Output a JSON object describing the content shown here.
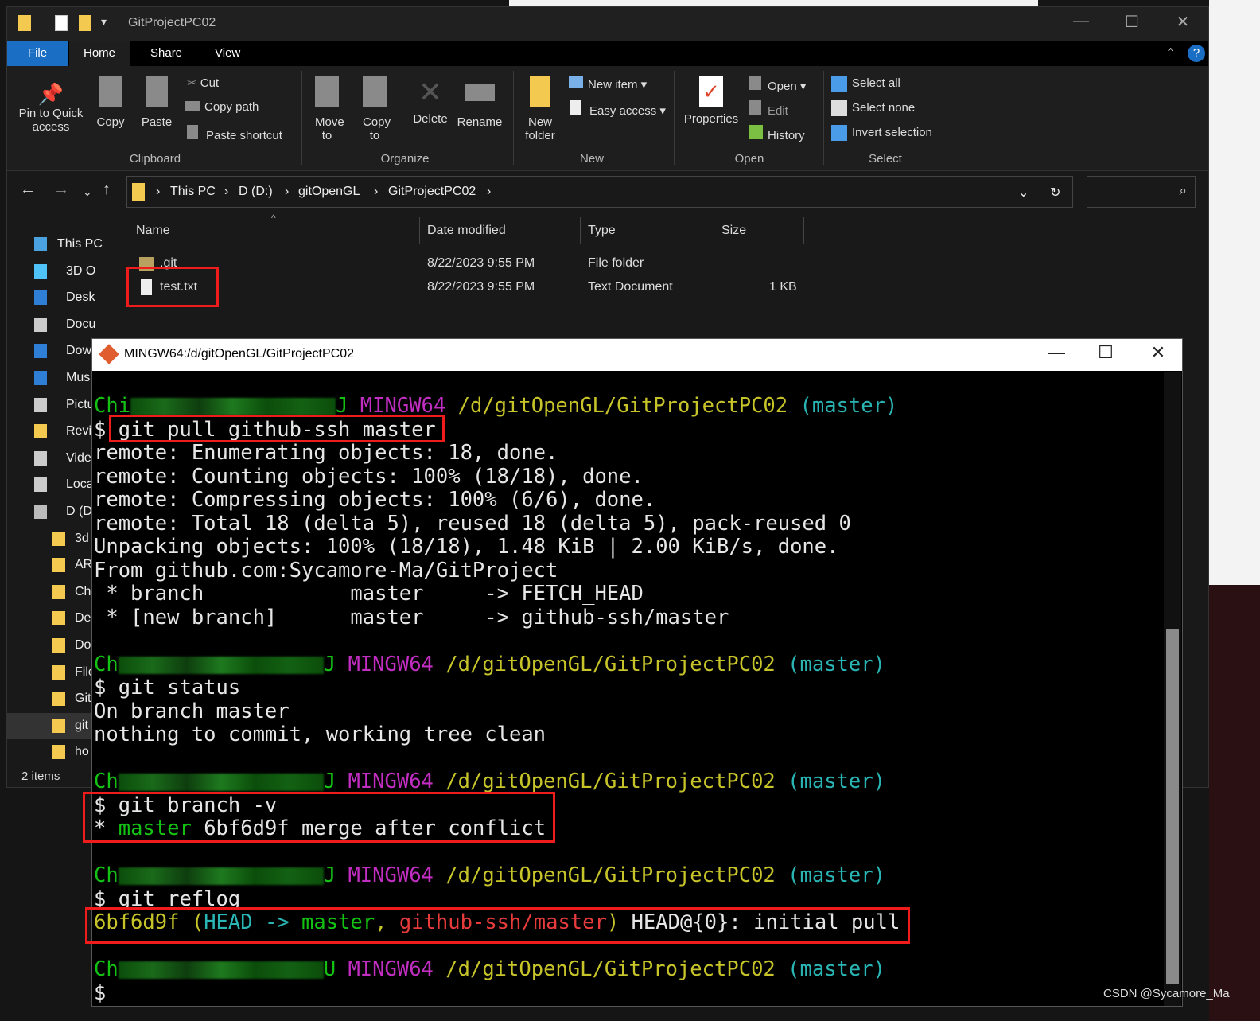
{
  "explorer": {
    "title": "GitProjectPC02",
    "tabs": [
      "File",
      "Home",
      "Share",
      "View"
    ],
    "ribbon": {
      "clipboard": {
        "pin": "Pin to Quick access",
        "copy": "Copy",
        "paste": "Paste",
        "cut": "Cut",
        "copy_path": "Copy path",
        "paste_shortcut": "Paste shortcut",
        "label": "Clipboard"
      },
      "organize": {
        "move": "Move to",
        "copy": "Copy to",
        "delete": "Delete",
        "rename": "Rename",
        "label": "Organize"
      },
      "new": {
        "folder": "New folder",
        "item": "New item",
        "easy": "Easy access",
        "label": "New"
      },
      "open": {
        "properties": "Properties",
        "open": "Open",
        "edit": "Edit",
        "history": "History",
        "label": "Open"
      },
      "select": {
        "all": "Select all",
        "none": "Select none",
        "invert": "Invert selection",
        "label": "Select"
      }
    },
    "breadcrumb": [
      "This PC",
      "D (D:)",
      "gitOpenGL",
      "GitProjectPC02"
    ],
    "sidebar": [
      "This PC",
      "3D O",
      "Desk",
      "Docu",
      "Dow",
      "Mus",
      "Pictu",
      "Revi",
      "Vide",
      "Loca",
      "D (D",
      "3d",
      "AR",
      "Ch",
      "Del",
      "Do",
      "File",
      "Git",
      "git",
      "ho"
    ],
    "columns": [
      "Name",
      "Date modified",
      "Type",
      "Size"
    ],
    "files": [
      {
        "name": ".git",
        "date": "8/22/2023 9:55 PM",
        "type": "File folder",
        "size": ""
      },
      {
        "name": "test.txt",
        "date": "8/22/2023 9:55 PM",
        "type": "Text Document",
        "size": "1 KB"
      }
    ],
    "status": "2 items"
  },
  "terminal": {
    "title": "MINGW64:/d/gitOpenGL/GitProjectPC02",
    "colors": {
      "green": "#13c213",
      "magenta": "#c12ec1",
      "yellow": "#c7c42a",
      "cyan": "#2ab5b5",
      "red": "#e83b3b",
      "white": "#e6e6e6"
    },
    "lines": [
      [
        {
          "t": "Chi",
          "c": "green"
        },
        {
          "blur": true
        },
        {
          "t": "J ",
          "c": "green"
        },
        {
          "t": "MINGW64 ",
          "c": "magenta"
        },
        {
          "t": "/d/gitOpenGL/GitProjectPC02 ",
          "c": "yellow"
        },
        {
          "t": "(master)",
          "c": "cyan"
        }
      ],
      [
        {
          "t": "$ git pull github-ssh master",
          "c": "white"
        }
      ],
      [
        {
          "t": "remote: Enumerating objects: 18, done.",
          "c": "white"
        }
      ],
      [
        {
          "t": "remote: Counting objects: 100% (18/18), done.",
          "c": "white"
        }
      ],
      [
        {
          "t": "remote: Compressing objects: 100% (6/6), done.",
          "c": "white"
        }
      ],
      [
        {
          "t": "remote: Total 18 (delta 5), reused 18 (delta 5), pack-reused 0",
          "c": "white"
        }
      ],
      [
        {
          "t": "Unpacking objects: 100% (18/18), 1.48 KiB | 2.00 KiB/s, done.",
          "c": "white"
        }
      ],
      [
        {
          "t": "From github.com:Sycamore-Ma/GitProject",
          "c": "white"
        }
      ],
      [
        {
          "t": " * branch            master     -> FETCH_HEAD",
          "c": "white"
        }
      ],
      [
        {
          "t": " * [new branch]      master     -> github-ssh/master",
          "c": "white"
        }
      ],
      [],
      [
        {
          "t": "Ch",
          "c": "green"
        },
        {
          "blur": true
        },
        {
          "t": "J ",
          "c": "green"
        },
        {
          "t": "MINGW64 ",
          "c": "magenta"
        },
        {
          "t": "/d/gitOpenGL/GitProjectPC02 ",
          "c": "yellow"
        },
        {
          "t": "(master)",
          "c": "cyan"
        }
      ],
      [
        {
          "t": "$ git status",
          "c": "white"
        }
      ],
      [
        {
          "t": "On branch master",
          "c": "white"
        }
      ],
      [
        {
          "t": "nothing to commit, working tree clean",
          "c": "white"
        }
      ],
      [],
      [
        {
          "t": "Ch",
          "c": "green"
        },
        {
          "blur": true
        },
        {
          "t": "J ",
          "c": "green"
        },
        {
          "t": "MINGW64 ",
          "c": "magenta"
        },
        {
          "t": "/d/gitOpenGL/GitProjectPC02 ",
          "c": "yellow"
        },
        {
          "t": "(master)",
          "c": "cyan"
        }
      ],
      [
        {
          "t": "$ git branch -v",
          "c": "white"
        }
      ],
      [
        {
          "t": "* ",
          "c": "white"
        },
        {
          "t": "master",
          "c": "green"
        },
        {
          "t": " 6bf6d9f merge after conflict",
          "c": "white"
        }
      ],
      [],
      [
        {
          "t": "Ch",
          "c": "green"
        },
        {
          "blur": true
        },
        {
          "t": "J ",
          "c": "green"
        },
        {
          "t": "MINGW64 ",
          "c": "magenta"
        },
        {
          "t": "/d/gitOpenGL/GitProjectPC02 ",
          "c": "yellow"
        },
        {
          "t": "(master)",
          "c": "cyan"
        }
      ],
      [
        {
          "t": "$ git reflog",
          "c": "white"
        }
      ],
      [
        {
          "t": "6bf6d9f ",
          "c": "yellow"
        },
        {
          "t": "(",
          "c": "yellow"
        },
        {
          "t": "HEAD -> ",
          "c": "cyan"
        },
        {
          "t": "master",
          "c": "green"
        },
        {
          "t": ", ",
          "c": "yellow"
        },
        {
          "t": "github-ssh/master",
          "c": "red"
        },
        {
          "t": ")",
          "c": "yellow"
        },
        {
          "t": " HEAD@{0}: initial pull",
          "c": "white"
        }
      ],
      [],
      [
        {
          "t": "Ch",
          "c": "green"
        },
        {
          "blur": true
        },
        {
          "t": "U ",
          "c": "green"
        },
        {
          "t": "MINGW64 ",
          "c": "magenta"
        },
        {
          "t": "/d/gitOpenGL/GitProjectPC02 ",
          "c": "yellow"
        },
        {
          "t": "(master)",
          "c": "cyan"
        }
      ],
      [
        {
          "t": "$",
          "c": "white"
        }
      ]
    ]
  },
  "watermark": "CSDN @Sycamore_Ma"
}
